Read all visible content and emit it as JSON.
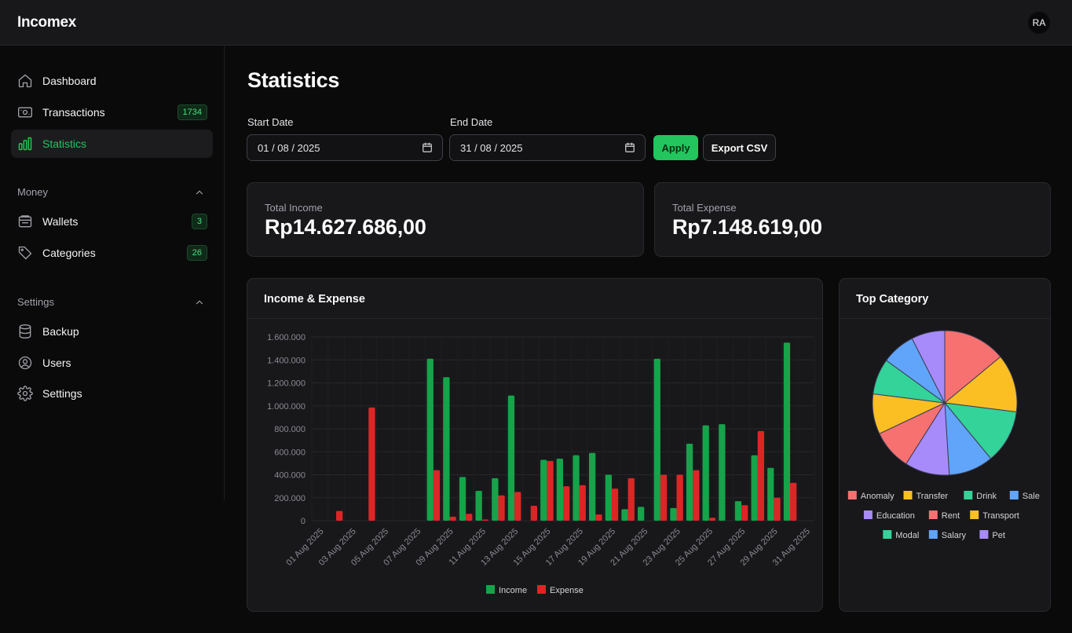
{
  "app": {
    "brand": "Incomex",
    "user_initials": "RA"
  },
  "sidebar": {
    "main_items": [
      {
        "label": "Dashboard",
        "icon": "home-icon"
      },
      {
        "label": "Transactions",
        "icon": "banknote-icon",
        "badge": "1734"
      },
      {
        "label": "Statistics",
        "icon": "bar-chart-icon",
        "active": true
      }
    ],
    "money": {
      "title": "Money",
      "items": [
        {
          "label": "Wallets",
          "icon": "wallet-icon",
          "badge": "3"
        },
        {
          "label": "Categories",
          "icon": "tag-icon",
          "badge": "26"
        }
      ]
    },
    "settings": {
      "title": "Settings",
      "items": [
        {
          "label": "Backup",
          "icon": "database-icon"
        },
        {
          "label": "Users",
          "icon": "user-circle-icon"
        },
        {
          "label": "Settings",
          "icon": "gear-icon"
        }
      ]
    }
  },
  "page": {
    "title": "Statistics"
  },
  "filters": {
    "start_label": "Start Date",
    "start_value": "01 / 08 / 2025",
    "end_label": "End Date",
    "end_value": "31 / 08 / 2025",
    "apply_label": "Apply",
    "export_label": "Export CSV"
  },
  "totals": {
    "income_label": "Total Income",
    "income_value": "Rp14.627.686,00",
    "expense_label": "Total Expense",
    "expense_value": "Rp7.148.619,00"
  },
  "colors": {
    "accent": "#22c55e",
    "income": "#16a34a",
    "expense": "#dc2626"
  },
  "charts": {
    "bar_title": "Income & Expense",
    "pie_title": "Top Category"
  },
  "chart_data": [
    {
      "type": "bar",
      "title": "Income & Expense",
      "categories": [
        "01 Aug 2025",
        "02 Aug 2025",
        "03 Aug 2025",
        "04 Aug 2025",
        "05 Aug 2025",
        "06 Aug 2025",
        "07 Aug 2025",
        "08 Aug 2025",
        "09 Aug 2025",
        "10 Aug 2025",
        "11 Aug 2025",
        "12 Aug 2025",
        "13 Aug 2025",
        "14 Aug 2025",
        "15 Aug 2025",
        "16 Aug 2025",
        "17 Aug 2025",
        "18 Aug 2025",
        "19 Aug 2025",
        "20 Aug 2025",
        "21 Aug 2025",
        "22 Aug 2025",
        "23 Aug 2025",
        "24 Aug 2025",
        "25 Aug 2025",
        "26 Aug 2025",
        "27 Aug 2025",
        "28 Aug 2025",
        "29 Aug 2025",
        "30 Aug 2025",
        "31 Aug 2025"
      ],
      "tick_labels": [
        "01 Aug 2025",
        "03 Aug 2025",
        "05 Aug 2025",
        "07 Aug 2025",
        "09 Aug 2025",
        "11 Aug 2025",
        "13 Aug 2025",
        "15 Aug 2025",
        "17 Aug 2025",
        "19 Aug 2025",
        "21 Aug 2025",
        "23 Aug 2025",
        "25 Aug 2025",
        "27 Aug 2025",
        "29 Aug 2025",
        "31 Aug 2025"
      ],
      "series": [
        {
          "name": "Income",
          "color": "#16a34a",
          "values": [
            0,
            0,
            0,
            0,
            0,
            0,
            0,
            1410000,
            1250000,
            380000,
            260000,
            370000,
            1090000,
            0,
            530000,
            540000,
            570000,
            590000,
            400000,
            100000,
            120000,
            1410000,
            110000,
            670000,
            830000,
            840000,
            170000,
            570000,
            460000,
            1550000,
            0
          ]
        },
        {
          "name": "Expense",
          "color": "#dc2626",
          "values": [
            0,
            85000,
            0,
            985000,
            0,
            0,
            0,
            440000,
            35000,
            60000,
            10000,
            220000,
            250000,
            130000,
            520000,
            300000,
            310000,
            55000,
            280000,
            370000,
            0,
            400000,
            400000,
            440000,
            25000,
            0,
            135000,
            780000,
            200000,
            330000,
            0
          ]
        }
      ],
      "yticks": [
        "0",
        "200.000",
        "400.000",
        "600.000",
        "800.000",
        "1.000.000",
        "1.200.000",
        "1.400.000",
        "1.600.000"
      ],
      "ylim": [
        0,
        1600000
      ],
      "legend": "bottom",
      "grid": true
    },
    {
      "type": "pie",
      "title": "Top Category",
      "slices": [
        {
          "label": "Anomaly",
          "value": 14,
          "color": "#f87171"
        },
        {
          "label": "Transfer",
          "value": 13,
          "color": "#fbbf24"
        },
        {
          "label": "Drink",
          "value": 12,
          "color": "#34d399"
        },
        {
          "label": "Sale",
          "value": 10,
          "color": "#60a5fa"
        },
        {
          "label": "Education",
          "value": 10,
          "color": "#a78bfa"
        },
        {
          "label": "Rent",
          "value": 9,
          "color": "#f87171"
        },
        {
          "label": "Transport",
          "value": 9,
          "color": "#fbbf24"
        },
        {
          "label": "Modal",
          "value": 8,
          "color": "#34d399"
        },
        {
          "label": "Salary",
          "value": 7.5,
          "color": "#60a5fa"
        },
        {
          "label": "Pet",
          "value": 7.5,
          "color": "#a78bfa"
        }
      ],
      "legend": "bottom"
    }
  ]
}
